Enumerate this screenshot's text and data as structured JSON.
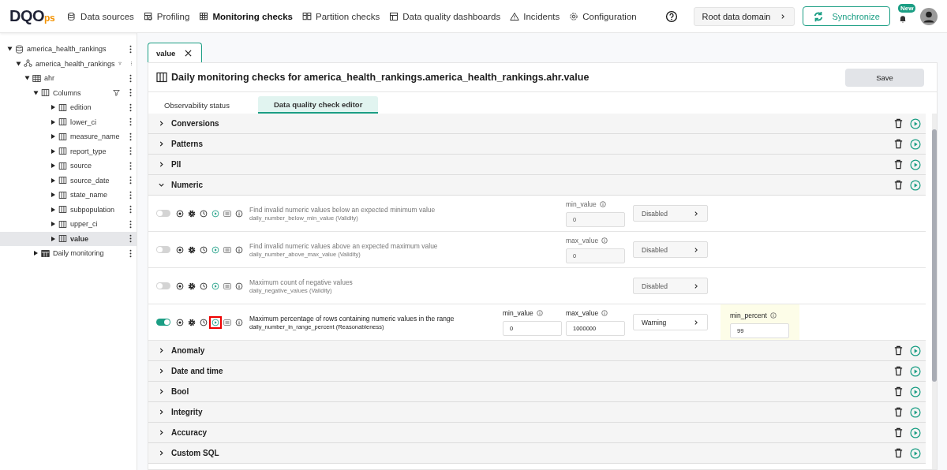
{
  "logo": {
    "main": "DQO",
    "suffix": "ps"
  },
  "nav": [
    {
      "label": "Data sources",
      "kind": "sources",
      "selected": false
    },
    {
      "label": "Profiling",
      "kind": "profiling",
      "selected": false
    },
    {
      "label": "Monitoring checks",
      "kind": "monitoring",
      "selected": true
    },
    {
      "label": "Partition checks",
      "kind": "partition",
      "selected": false
    },
    {
      "label": "Data quality dashboards",
      "kind": "dashboards",
      "selected": false
    },
    {
      "label": "Incidents",
      "kind": "incidents",
      "selected": false
    },
    {
      "label": "Configuration",
      "kind": "configuration",
      "selected": false
    }
  ],
  "header_right": {
    "domain": "Root data domain",
    "sync": "Synchronize",
    "badge": "New"
  },
  "tree": [
    {
      "label": "america_health_rankings",
      "kind": "database",
      "expanded": true,
      "selected": false,
      "filter": false,
      "children": [
        {
          "label": "america_health_rankings",
          "kind": "schema",
          "expanded": true,
          "selected": false,
          "filter": true,
          "children": [
            {
              "label": "ahr",
              "kind": "table",
              "expanded": true,
              "selected": false,
              "filter": false,
              "children": [
                {
                  "label": "Columns",
                  "kind": "columns",
                  "expanded": true,
                  "selected": false,
                  "filter": true,
                  "children": [
                    {
                      "label": "edition",
                      "kind": "column",
                      "expanded": false,
                      "selected": false,
                      "filter": false
                    },
                    {
                      "label": "lower_ci",
                      "kind": "column",
                      "expanded": false,
                      "selected": false,
                      "filter": false
                    },
                    {
                      "label": "measure_name",
                      "kind": "column",
                      "expanded": false,
                      "selected": false,
                      "filter": false
                    },
                    {
                      "label": "report_type",
                      "kind": "column",
                      "expanded": false,
                      "selected": false,
                      "filter": false
                    },
                    {
                      "label": "source",
                      "kind": "column",
                      "expanded": false,
                      "selected": false,
                      "filter": false
                    },
                    {
                      "label": "source_date",
                      "kind": "column",
                      "expanded": false,
                      "selected": false,
                      "filter": false
                    },
                    {
                      "label": "state_name",
                      "kind": "column",
                      "expanded": false,
                      "selected": false,
                      "filter": false
                    },
                    {
                      "label": "subpopulation",
                      "kind": "column",
                      "expanded": false,
                      "selected": false,
                      "filter": false
                    },
                    {
                      "label": "upper_ci",
                      "kind": "column",
                      "expanded": false,
                      "selected": false,
                      "filter": false
                    },
                    {
                      "label": "value",
                      "kind": "column",
                      "expanded": false,
                      "selected": true,
                      "filter": false
                    }
                  ]
                },
                {
                  "label": "Daily monitoring",
                  "kind": "monitoring",
                  "expanded": false,
                  "selected": false,
                  "filter": false
                }
              ]
            }
          ]
        }
      ]
    }
  ],
  "open_tab": {
    "label": "value"
  },
  "panel": {
    "title": "Daily monitoring checks for america_health_rankings.america_health_rankings.ahr.value",
    "save": "Save",
    "tabs": [
      {
        "label": "Observability status",
        "selected": false
      },
      {
        "label": "Data quality check editor",
        "selected": true
      }
    ]
  },
  "categories": [
    {
      "name": "Conversions",
      "expanded": false
    },
    {
      "name": "Patterns",
      "expanded": false
    },
    {
      "name": "PII",
      "expanded": false
    },
    {
      "name": "Numeric",
      "expanded": true,
      "checks": [
        {
          "title": "Find invalid numeric values below an expected minimum value",
          "id": "daily_number_below_min_value (Validity)",
          "enabled": false,
          "play_highlighted": false,
          "params": [
            {
              "label": "min_value",
              "value": "0"
            }
          ],
          "severity": "Disabled"
        },
        {
          "title": "Find invalid numeric values above an expected maximum value",
          "id": "daily_number_above_max_value (Validity)",
          "enabled": false,
          "play_highlighted": false,
          "params": [
            {
              "label": "max_value",
              "value": "0"
            }
          ],
          "severity": "Disabled"
        },
        {
          "title": "Maximum count of negative values",
          "id": "daily_negative_values (Validity)",
          "enabled": false,
          "play_highlighted": false,
          "severity": "Disabled"
        },
        {
          "title": "Maximum percentage of rows containing numeric values in the range",
          "id": "daily_number_in_range_percent (Reasonableness)",
          "enabled": true,
          "play_highlighted": true,
          "params": [
            {
              "label": "min_value",
              "value": "0"
            },
            {
              "label": "max_value",
              "value": "1000000"
            }
          ],
          "severity": "Warning",
          "rule": {
            "label": "min_percent",
            "value": "99"
          }
        }
      ]
    },
    {
      "name": "Anomaly",
      "expanded": false
    },
    {
      "name": "Date and time",
      "expanded": false
    },
    {
      "name": "Bool",
      "expanded": false
    },
    {
      "name": "Integrity",
      "expanded": false
    },
    {
      "name": "Accuracy",
      "expanded": false
    },
    {
      "name": "Custom SQL",
      "expanded": false
    }
  ]
}
